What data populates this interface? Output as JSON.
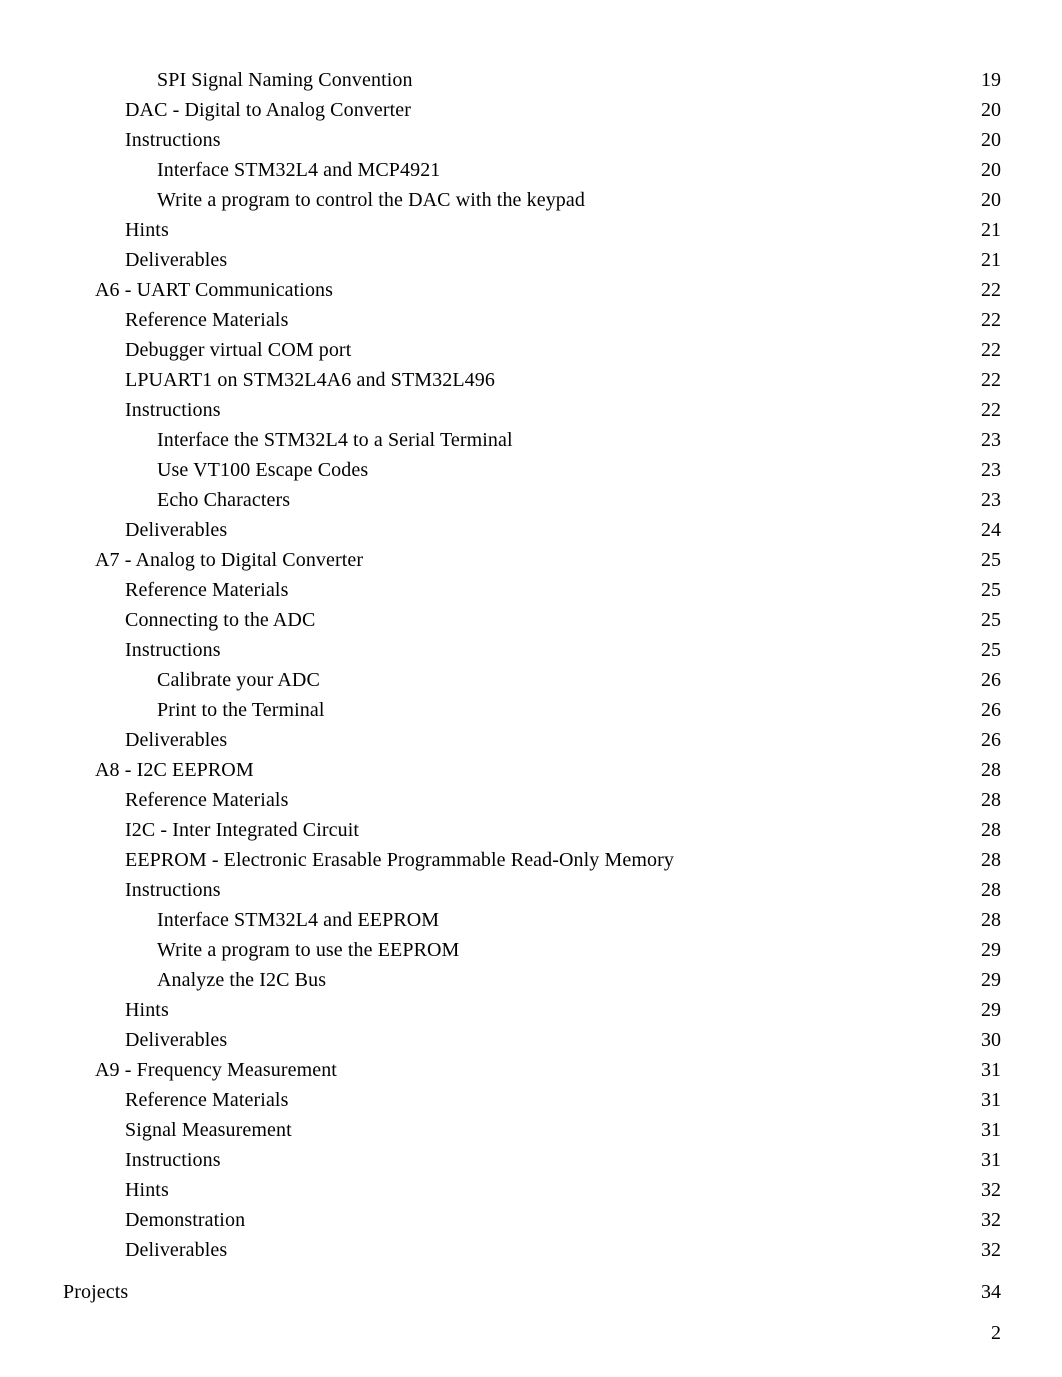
{
  "document": {
    "type": "table-of-contents",
    "page_footer_number": "2"
  },
  "toc": {
    "entries": [
      {
        "level": 3,
        "title": "SPI Signal Naming Convention",
        "page": "19"
      },
      {
        "level": 2,
        "title": "DAC - Digital to Analog Converter",
        "page": "20"
      },
      {
        "level": 2,
        "title": "Instructions",
        "page": "20"
      },
      {
        "level": 3,
        "title": "Interface STM32L4 and MCP4921",
        "page": "20"
      },
      {
        "level": 3,
        "title": "Write a program to control the DAC with the keypad",
        "page": "20"
      },
      {
        "level": 2,
        "title": "Hints",
        "page": "21"
      },
      {
        "level": 2,
        "title": "Deliverables",
        "page": "21"
      },
      {
        "level": 1,
        "title": "A6 - UART Communications",
        "page": "22"
      },
      {
        "level": 2,
        "title": "Reference Materials",
        "page": "22"
      },
      {
        "level": 2,
        "title": "Debugger virtual COM port",
        "page": "22"
      },
      {
        "level": 2,
        "title": "LPUART1 on STM32L4A6 and STM32L496",
        "page": "22"
      },
      {
        "level": 2,
        "title": "Instructions",
        "page": "22"
      },
      {
        "level": 3,
        "title": "Interface the STM32L4 to a Serial Terminal",
        "page": "23"
      },
      {
        "level": 3,
        "title": "Use VT100 Escape Codes",
        "page": "23"
      },
      {
        "level": 3,
        "title": "Echo Characters",
        "page": "23"
      },
      {
        "level": 2,
        "title": "Deliverables",
        "page": "24"
      },
      {
        "level": 1,
        "title": "A7 - Analog to Digital Converter",
        "page": "25"
      },
      {
        "level": 2,
        "title": "Reference Materials",
        "page": "25"
      },
      {
        "level": 2,
        "title": "Connecting to the ADC",
        "page": "25"
      },
      {
        "level": 2,
        "title": "Instructions",
        "page": "25"
      },
      {
        "level": 3,
        "title": "Calibrate your ADC",
        "page": "26"
      },
      {
        "level": 3,
        "title": "Print to the Terminal",
        "page": "26"
      },
      {
        "level": 2,
        "title": "Deliverables",
        "page": "26"
      },
      {
        "level": 1,
        "title": "A8 - I2C EEPROM",
        "page": "28"
      },
      {
        "level": 2,
        "title": "Reference Materials",
        "page": "28"
      },
      {
        "level": 2,
        "title": "I2C - Inter Integrated Circuit",
        "page": "28"
      },
      {
        "level": 2,
        "title": "EEPROM - Electronic Erasable Programmable Read-Only Memory",
        "page": "28"
      },
      {
        "level": 2,
        "title": "Instructions",
        "page": "28"
      },
      {
        "level": 3,
        "title": "Interface STM32L4 and EEPROM",
        "page": "28"
      },
      {
        "level": 3,
        "title": "Write a program to use the EEPROM",
        "page": "29"
      },
      {
        "level": 3,
        "title": "Analyze the I2C Bus",
        "page": "29"
      },
      {
        "level": 2,
        "title": "Hints",
        "page": "29"
      },
      {
        "level": 2,
        "title": "Deliverables",
        "page": "30"
      },
      {
        "level": 1,
        "title": "A9 - Frequency Measurement",
        "page": "31"
      },
      {
        "level": 2,
        "title": "Reference Materials",
        "page": "31"
      },
      {
        "level": 2,
        "title": "Signal Measurement",
        "page": "31"
      },
      {
        "level": 2,
        "title": "Instructions",
        "page": "31"
      },
      {
        "level": 2,
        "title": "Hints",
        "page": "32"
      },
      {
        "level": 2,
        "title": "Demonstration",
        "page": "32"
      },
      {
        "level": 2,
        "title": "Deliverables",
        "page": "32"
      },
      {
        "level": 0,
        "title": "Projects",
        "page": "34",
        "gap_before": true
      }
    ]
  }
}
